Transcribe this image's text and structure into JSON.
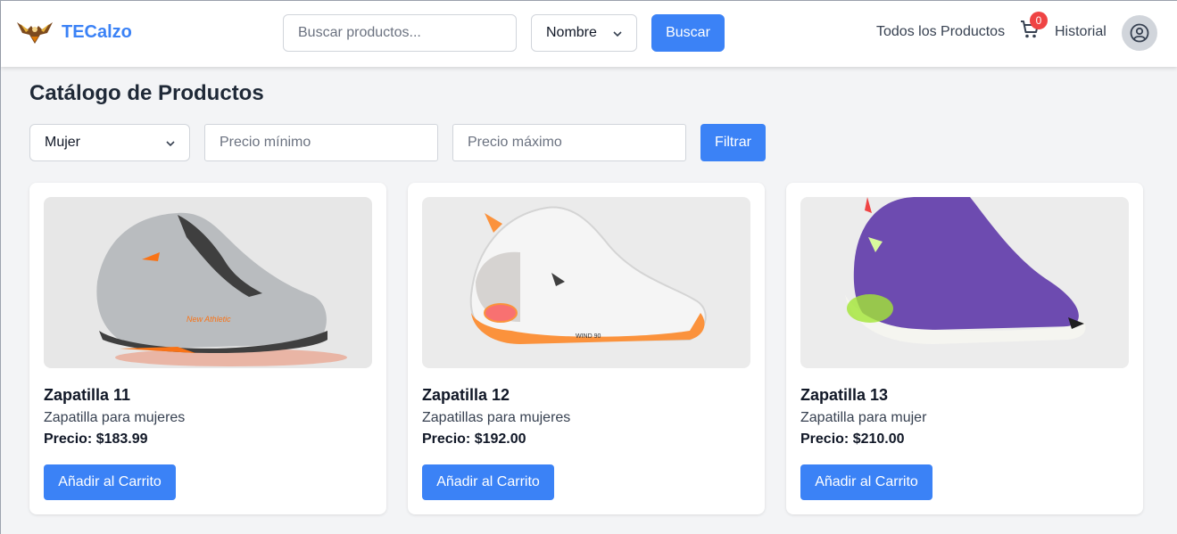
{
  "header": {
    "brand": "TECalzo",
    "search_placeholder": "Buscar productos...",
    "sort_value": "Nombre",
    "search_button": "Buscar",
    "nav_all_products": "Todos los Productos",
    "cart_count": "0",
    "nav_history": "Historial"
  },
  "main": {
    "title": "Catálogo de Productos",
    "filters": {
      "gender_value": "Mujer",
      "min_price_placeholder": "Precio mínimo",
      "max_price_placeholder": "Precio máximo",
      "filter_button": "Filtrar"
    },
    "products": [
      {
        "name": "Zapatilla 11",
        "description": "Zapatilla para mujeres",
        "price": "Precio: $183.99",
        "button": "Añadir al Carrito",
        "colors": {
          "body": "#b9bcbf",
          "accent": "#f97316",
          "sole": "#3f3f3f"
        }
      },
      {
        "name": "Zapatilla 12",
        "description": "Zapatillas para mujeres",
        "price": "Precio: $192.00",
        "button": "Añadir al Carrito",
        "colors": {
          "body": "#f5f5f5",
          "accent": "#fb923c",
          "sole": "#d6d3d1"
        }
      },
      {
        "name": "Zapatilla 13",
        "description": "Zapatilla para mujer",
        "price": "Precio: $210.00",
        "button": "Añadir al Carrito",
        "colors": {
          "body": "#6d4bb0",
          "accent": "#a3e635",
          "sole": "#f5f5f0"
        }
      }
    ]
  },
  "colors": {
    "accent": "#3b82f6",
    "badge": "#ef4444",
    "background": "#f3f4f6"
  }
}
